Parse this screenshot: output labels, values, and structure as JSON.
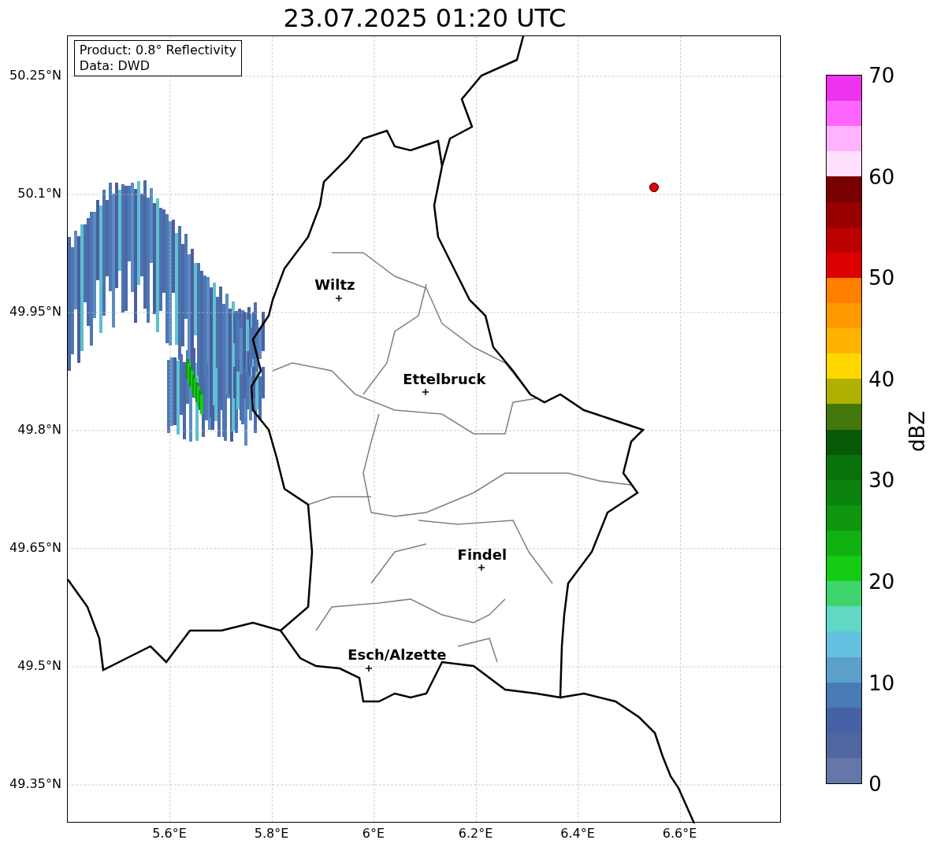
{
  "title": "23.07.2025 01:20 UTC",
  "info_box": [
    "Product: 0.8° Reflectivity",
    "Data: DWD"
  ],
  "cities": [
    {
      "name": "Wiltz"
    },
    {
      "name": "Ettelbruck"
    },
    {
      "name": "Findel"
    },
    {
      "name": "Esch/Alzette"
    }
  ],
  "lat_labels": [
    "50.25°N",
    "50.1°N",
    "49.95°N",
    "49.8°N",
    "49.65°N",
    "49.5°N",
    "49.35°N"
  ],
  "lon_labels": [
    "5.6°E",
    "5.8°E",
    "6°E",
    "6.2°E",
    "6.4°E",
    "6.6°E"
  ],
  "colorbar": {
    "label": "dBZ",
    "ticks": [
      "70",
      "60",
      "50",
      "40",
      "30",
      "20",
      "10",
      "0"
    ],
    "bands": [
      {
        "color": "#ee33ee"
      },
      {
        "color": "#ff66ff"
      },
      {
        "color": "#ffb3ff"
      },
      {
        "color": "#ffe0ff"
      },
      {
        "color": "#780000"
      },
      {
        "color": "#990000"
      },
      {
        "color": "#bb0000"
      },
      {
        "color": "#dd0000"
      },
      {
        "color": "#ff7f00"
      },
      {
        "color": "#ff9900"
      },
      {
        "color": "#ffb300"
      },
      {
        "color": "#ffd800"
      },
      {
        "color": "#b0b000"
      },
      {
        "color": "#447709"
      },
      {
        "color": "#075907"
      },
      {
        "color": "#0a720a"
      },
      {
        "color": "#0b820b"
      },
      {
        "color": "#0e960e"
      },
      {
        "color": "#10b010"
      },
      {
        "color": "#14cc14"
      },
      {
        "color": "#3dd56b"
      },
      {
        "color": "#60d8c4"
      },
      {
        "color": "#64c1e0"
      },
      {
        "color": "#5ba0c8"
      },
      {
        "color": "#4a7ab8"
      },
      {
        "color": "#4661a6"
      },
      {
        "color": "#5066a0"
      },
      {
        "color": "#6577a8"
      }
    ]
  }
}
